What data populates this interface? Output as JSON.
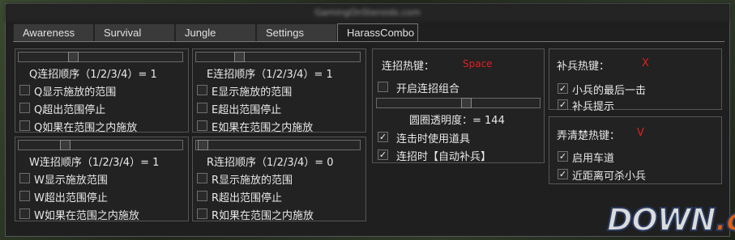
{
  "window": {
    "title": "GamingOnSteroids.com"
  },
  "tabs": [
    {
      "label": "Awareness"
    },
    {
      "label": "Survival"
    },
    {
      "label": "Jungle"
    },
    {
      "label": "Settings"
    },
    {
      "label": "HarassCombo"
    }
  ],
  "active_tab": "HarassCombo",
  "q": {
    "order_label": "Q连招顺序（1/2/3/4）= 1",
    "order_value": 1,
    "show_range": "Q显示施放的范围",
    "stop_out_range": "Q超出范围停止",
    "cast_in_range": "Q如果在范围之内施放"
  },
  "e": {
    "order_label": "E连招顺序（1/2/3/4）= 1",
    "order_value": 1,
    "show_range": "E显示施放的范围",
    "stop_out_range": "E超出范围停止",
    "cast_in_range": "E如果在范围之内施放"
  },
  "w": {
    "order_label": "W连招顺序（1/2/3/4）= 1",
    "order_value": 1,
    "show_range": "W显示施放范围",
    "stop_out_range": "W超出范围停止",
    "cast_in_range": "W如果在范围之内施放"
  },
  "r": {
    "order_label": "R连招顺序（1/2/3/4）= 0",
    "order_value": 0,
    "show_range": "R显示施放的范围",
    "stop_out_range": "R超出范围停止",
    "cast_in_range": "R如果在范围之内施放"
  },
  "combo": {
    "hotkey_label": "连招热键：",
    "hotkey_value": "Space",
    "enable_combo": "开启连招组合",
    "enable_combo_checked": false,
    "circle_opacity_label": "圆圈透明度：= 144",
    "circle_opacity_value": 144,
    "use_items": "连击时使用道具",
    "use_items_checked": true,
    "auto_lasthit": "连招时【自动补兵】",
    "auto_lasthit_checked": true
  },
  "lasthit": {
    "hotkey_label": "补兵热键：",
    "hotkey_value": "X",
    "last_hit_minion": "小兵的最后一击",
    "last_hit_minion_checked": true,
    "lasthit_hint": "补兵提示",
    "lasthit_hint_checked": true
  },
  "laneclear": {
    "hotkey_label": "弄清楚热键：",
    "hotkey_value": "V",
    "enable_lane": "启用车道",
    "enable_lane_checked": true,
    "near_killable": "近距离可杀小兵",
    "near_killable_checked": true
  },
  "watermark": {
    "main": "DOWN",
    "suffix": ".cc"
  },
  "colors": {
    "hotkey": "#e02020",
    "panel_bg": "#222222",
    "border": "#555555"
  }
}
